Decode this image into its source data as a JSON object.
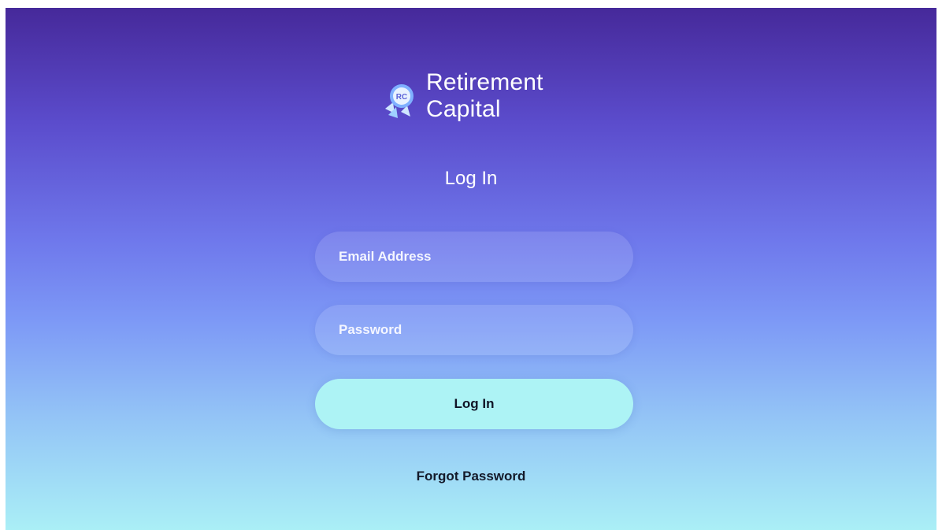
{
  "brand": {
    "name_line1": "Retirement",
    "name_line2": "Capital",
    "logo_icon": "rocket-icon",
    "logo_monogram": "RC"
  },
  "heading": "Log In",
  "form": {
    "email_placeholder": "Email Address",
    "password_placeholder": "Password",
    "submit_label": "Log In",
    "forgot_label": "Forgot Password"
  },
  "colors": {
    "gradient_top": "#46299a",
    "gradient_bottom": "#aaeff6",
    "button_bg": "#adf3f5",
    "text_light": "#ffffff",
    "text_dark": "#141a2a"
  }
}
